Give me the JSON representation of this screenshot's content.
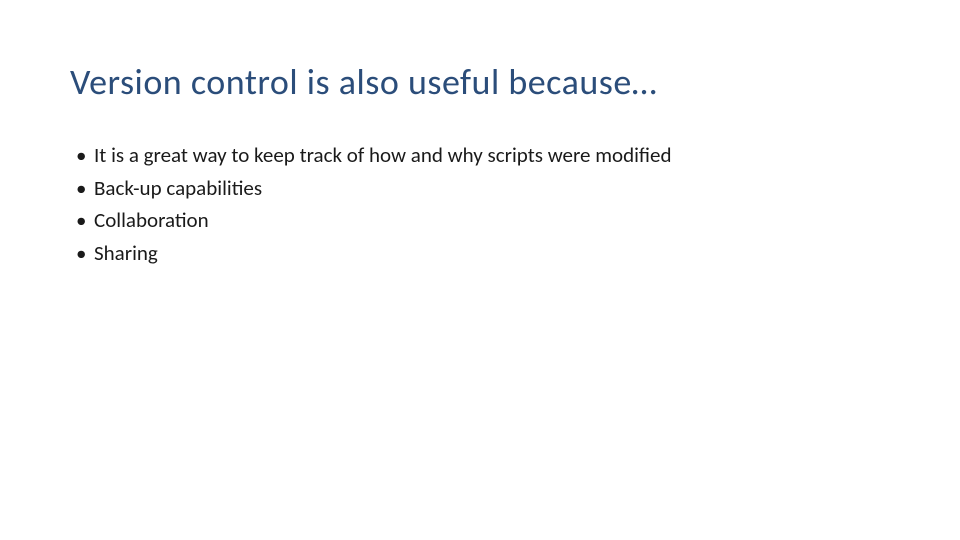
{
  "slide": {
    "title": "Version control is also useful because…",
    "bullets": [
      "It is a great way to keep track of how and why scripts were modified",
      "Back-up capabilities",
      "Collaboration",
      "Sharing"
    ]
  }
}
